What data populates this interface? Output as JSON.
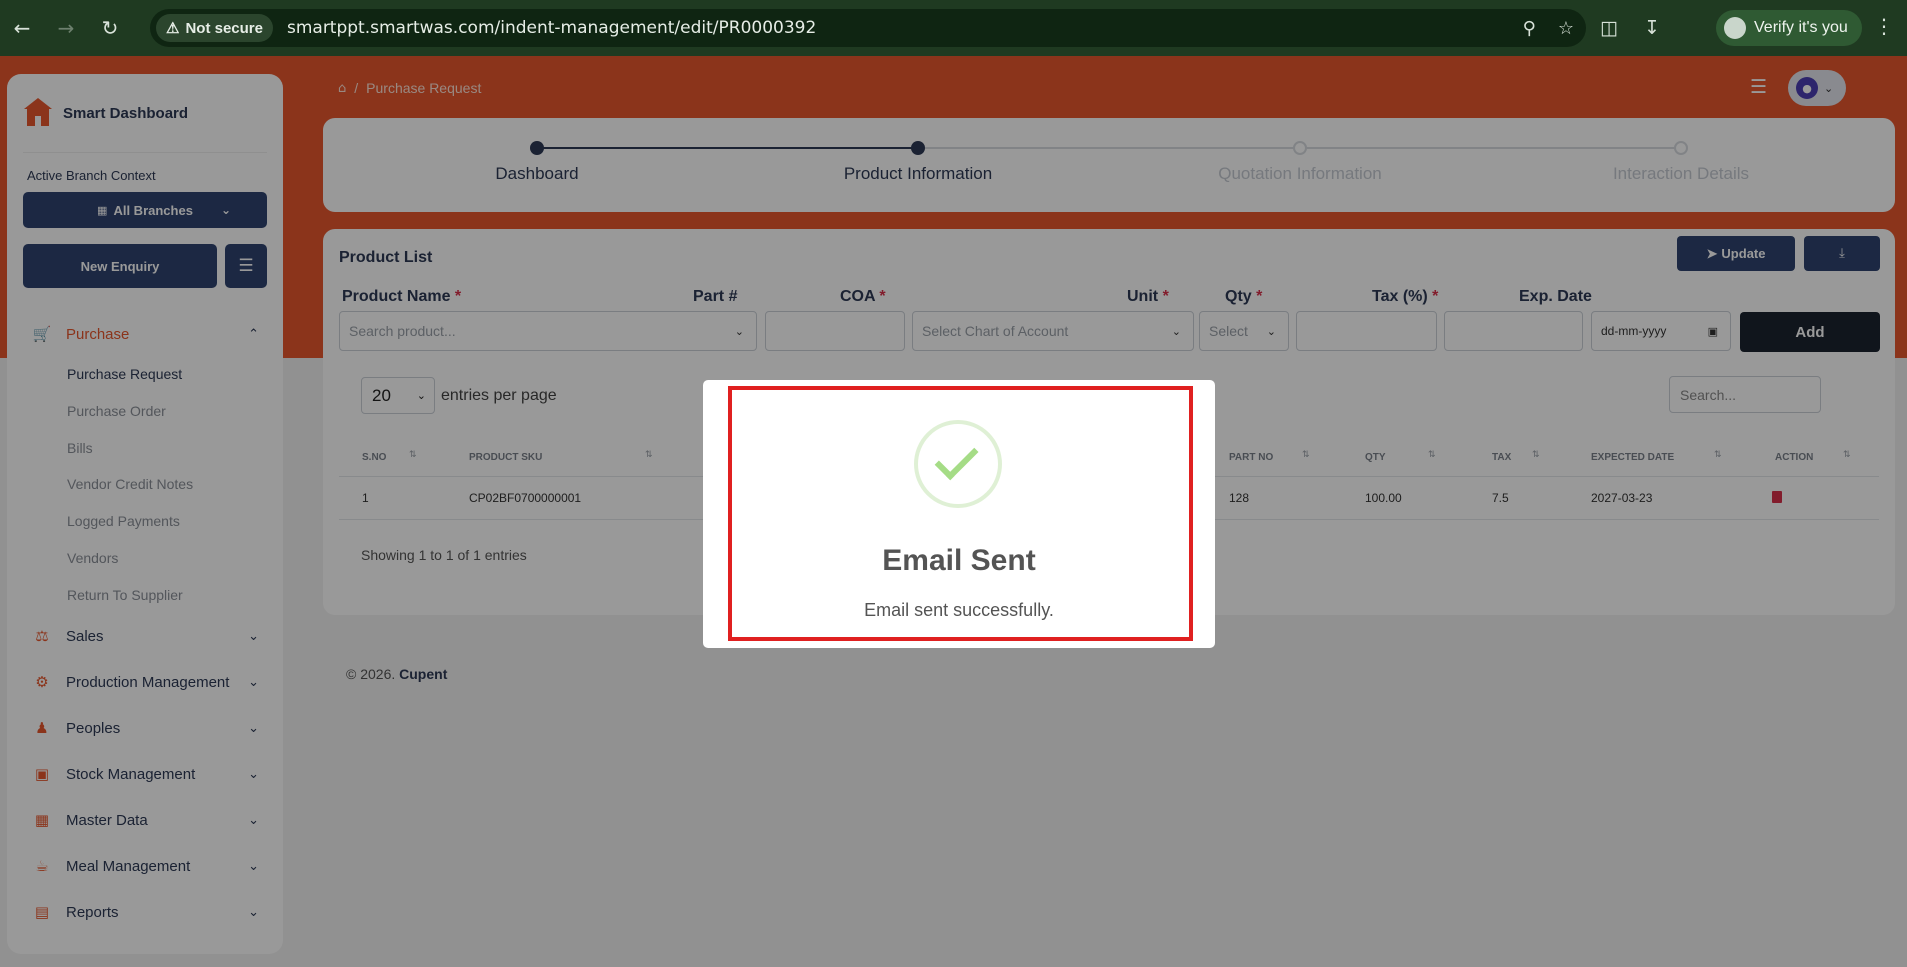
{
  "browser": {
    "security_label": "Not secure",
    "url": "smartppt.smartwas.com/indent-management/edit/PR0000392",
    "verify_label": "Verify it's you"
  },
  "sidebar": {
    "brand": "Smart Dashboard",
    "branch_context_label": "Active Branch Context",
    "branch_value": "All Branches",
    "new_enquiry_label": "New Enquiry",
    "purchase": {
      "label": "Purchase",
      "items": [
        {
          "label": "Purchase Request"
        },
        {
          "label": "Purchase Order"
        },
        {
          "label": "Bills"
        },
        {
          "label": "Vendor Credit Notes"
        },
        {
          "label": "Logged Payments"
        },
        {
          "label": "Vendors"
        },
        {
          "label": "Return To Supplier"
        }
      ]
    },
    "groups": [
      {
        "label": "Sales",
        "icon": "sales-icon"
      },
      {
        "label": "Production Management",
        "icon": "production-icon"
      },
      {
        "label": "Peoples",
        "icon": "peoples-icon"
      },
      {
        "label": "Stock Management",
        "icon": "stock-icon"
      },
      {
        "label": "Master Data",
        "icon": "master-data-icon"
      },
      {
        "label": "Meal Management",
        "icon": "meal-icon"
      },
      {
        "label": "Reports",
        "icon": "reports-icon"
      }
    ]
  },
  "header": {
    "breadcrumb_current": "Purchase Request"
  },
  "stepper": {
    "steps": [
      {
        "label": "Dashboard",
        "state": "done"
      },
      {
        "label": "Product Information",
        "state": "active"
      },
      {
        "label": "Quotation Information",
        "state": "pending"
      },
      {
        "label": "Interaction Details",
        "state": "pending"
      }
    ]
  },
  "product_card": {
    "title": "Product List",
    "update_label": "Update",
    "form": {
      "product_name_label": "Product Name",
      "product_name_placeholder": "Search product...",
      "part_label": "Part #",
      "coa_label": "COA",
      "coa_placeholder": "Select Chart of Account",
      "unit_label": "Unit",
      "unit_placeholder": "Select",
      "qty_label": "Qty",
      "tax_label": "Tax (%)",
      "exp_date_label": "Exp. Date",
      "exp_date_placeholder": "dd-mm-yyyy",
      "required_mark": "*",
      "add_label": "Add"
    },
    "table": {
      "page_length": "20",
      "page_length_suffix": "entries per page",
      "search_placeholder": "Search...",
      "columns": {
        "sno": "S.NO",
        "sku": "PRODUCT SKU",
        "part_no": "PART NO",
        "qty": "QTY",
        "tax": "TAX",
        "expected_date": "EXPECTED DATE",
        "action": "ACTION"
      },
      "rows": [
        {
          "sno": "1",
          "sku": "CP02BF0700000001",
          "part_no": "128",
          "qty": "100.00",
          "tax": "7.5",
          "expected_date": "2027-03-23"
        }
      ],
      "info": "Showing 1 to 1 of 1 entries"
    }
  },
  "footer": {
    "copyright": "© 2026.",
    "company": "Cupent"
  },
  "modal": {
    "title": "Email Sent",
    "text": "Email sent successfully."
  },
  "colors": {
    "accent": "#e8582e",
    "primary": "#2f4470",
    "success": "#a5dc86",
    "highlight": "#e02020"
  }
}
